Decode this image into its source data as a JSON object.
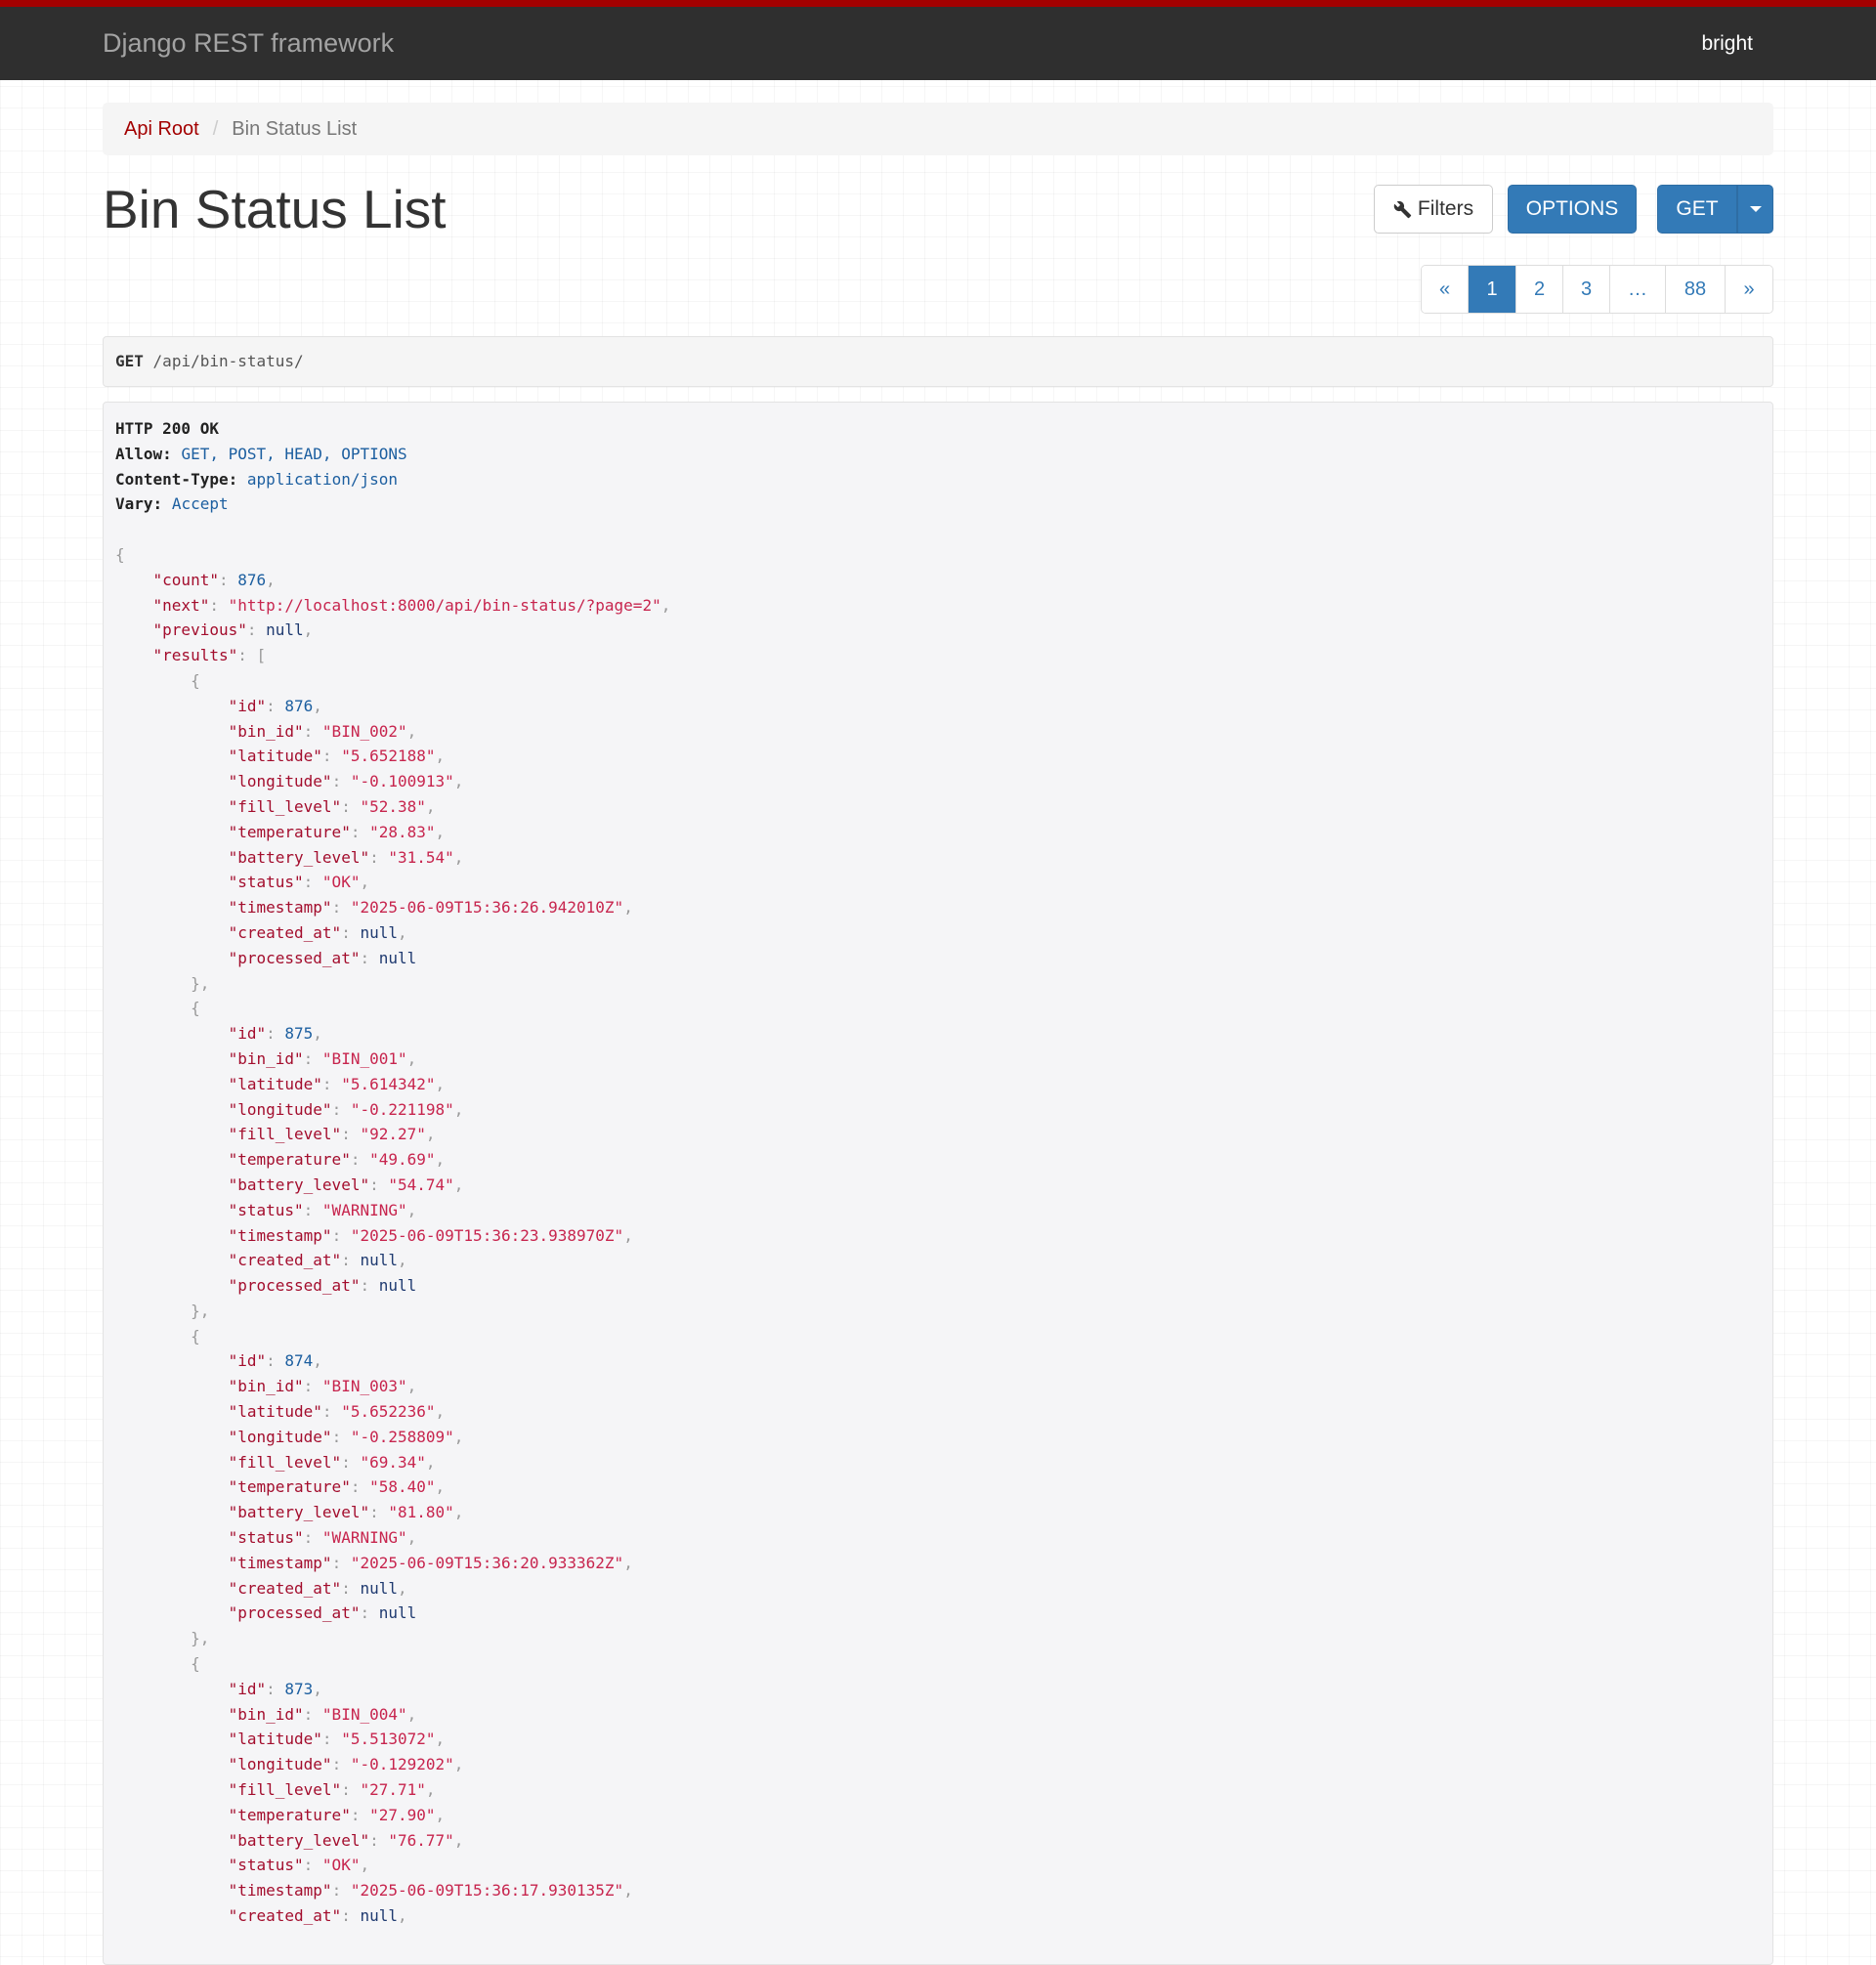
{
  "navbar": {
    "brand": "Django REST framework",
    "user": "bright"
  },
  "breadcrumb": {
    "root": "Api Root",
    "current": "Bin Status List"
  },
  "page_title": "Bin Status List",
  "buttons": {
    "filters": "Filters",
    "options": "OPTIONS",
    "get": "GET"
  },
  "pagination": {
    "prev": "«",
    "pages": [
      "1",
      "2",
      "3",
      "…",
      "88"
    ],
    "next": "»",
    "active": "1"
  },
  "request": {
    "method": "GET",
    "path": "/api/bin-status/"
  },
  "response_headers": {
    "status": "HTTP 200 OK",
    "allow_label": "Allow:",
    "allow": "GET, POST, HEAD, OPTIONS",
    "content_type_label": "Content-Type:",
    "content_type": "application/json",
    "vary_label": "Vary:",
    "vary": "Accept"
  },
  "response_body": {
    "count": 876,
    "next": "http://localhost:8000/api/bin-status/?page=2",
    "previous": null,
    "results": [
      {
        "id": 876,
        "bin_id": "BIN_002",
        "latitude": "5.652188",
        "longitude": "-0.100913",
        "fill_level": "52.38",
        "temperature": "28.83",
        "battery_level": "31.54",
        "status": "OK",
        "timestamp": "2025-06-09T15:36:26.942010Z",
        "created_at": null,
        "processed_at": null
      },
      {
        "id": 875,
        "bin_id": "BIN_001",
        "latitude": "5.614342",
        "longitude": "-0.221198",
        "fill_level": "92.27",
        "temperature": "49.69",
        "battery_level": "54.74",
        "status": "WARNING",
        "timestamp": "2025-06-09T15:36:23.938970Z",
        "created_at": null,
        "processed_at": null
      },
      {
        "id": 874,
        "bin_id": "BIN_003",
        "latitude": "5.652236",
        "longitude": "-0.258809",
        "fill_level": "69.34",
        "temperature": "58.40",
        "battery_level": "81.80",
        "status": "WARNING",
        "timestamp": "2025-06-09T15:36:20.933362Z",
        "created_at": null,
        "processed_at": null
      },
      {
        "id": 873,
        "bin_id": "BIN_004",
        "latitude": "5.513072",
        "longitude": "-0.129202",
        "fill_level": "27.71",
        "temperature": "27.90",
        "battery_level": "76.77",
        "status": "OK",
        "timestamp": "2025-06-09T15:36:17.930135Z",
        "created_at": null
      }
    ]
  }
}
